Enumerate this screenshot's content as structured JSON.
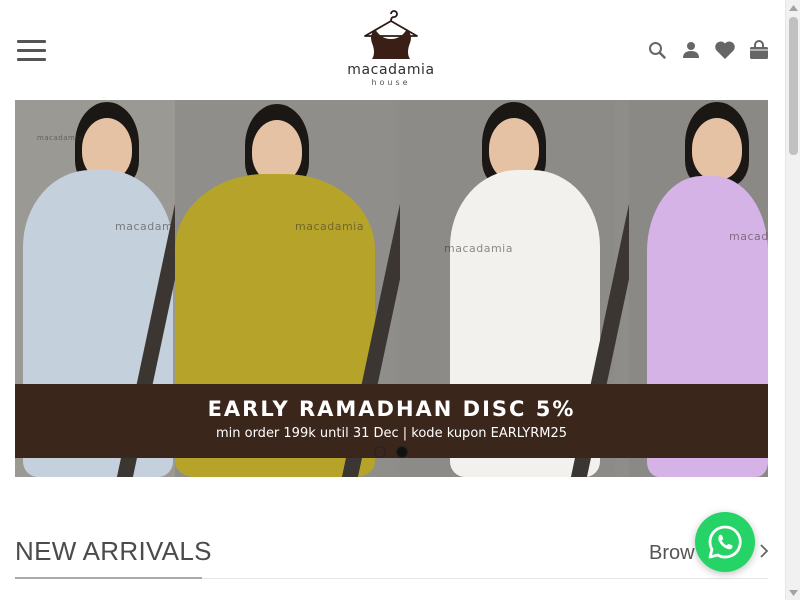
{
  "header": {
    "brand": "macadamia",
    "brand_sub": "house",
    "menu_icon": "hamburger-menu-icon",
    "actions": [
      {
        "name": "search",
        "icon": "search-icon"
      },
      {
        "name": "account",
        "icon": "user-icon"
      },
      {
        "name": "wishlist",
        "icon": "heart-icon"
      },
      {
        "name": "cart",
        "icon": "shopping-bag-icon"
      }
    ]
  },
  "banner": {
    "headline": "EARLY RAMADHAN DISC 5%",
    "subline": "min order 199k until 31 Dec | kode kupon EARLYRM25",
    "watermark": "macadamia",
    "watermark_sub": "house",
    "slides": 2,
    "active_slide": 2,
    "colors": {
      "band": "#3b261c",
      "background": "#8e8d89",
      "dress_1": "#c5d0dd",
      "dress_2": "#b6a42a",
      "dress_3": "#f2f1ee",
      "dress_4": "#d6b3e6"
    }
  },
  "new_arrivals": {
    "title": "NEW ARRIVALS",
    "browse_label": "Brow"
  },
  "whatsapp": {
    "icon": "whatsapp-icon",
    "color": "#25d366"
  },
  "scrollbar": {
    "up_icon": "scroll-up-arrow-icon",
    "down_icon": "scroll-down-arrow-icon"
  }
}
